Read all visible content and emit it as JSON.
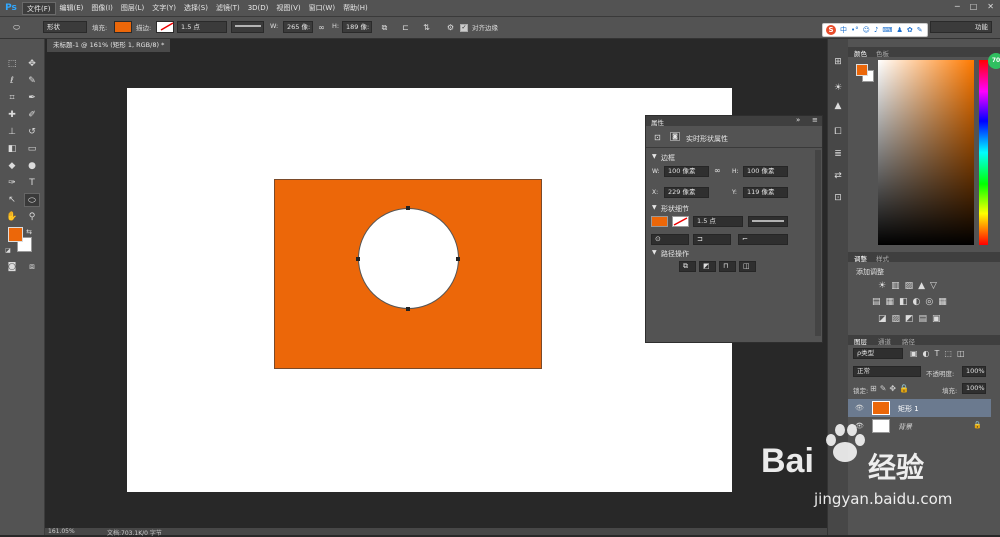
{
  "app": {
    "logo": "Ps"
  },
  "menu": [
    "文件(F)",
    "编辑(E)",
    "图像(I)",
    "图层(L)",
    "文字(Y)",
    "选择(S)",
    "滤镜(T)",
    "3D(D)",
    "视图(V)",
    "窗口(W)",
    "帮助(H)"
  ],
  "options": {
    "shape_mode": "形状",
    "fill_label": "填充:",
    "stroke_label": "描边:",
    "stroke_width": "1.5 点",
    "w_label": "W:",
    "w_value": "265 像:",
    "h_label": "H:",
    "h_value": "189 像:",
    "align_edges": "对齐边缘",
    "workspace": "功能"
  },
  "document": {
    "tab_title": "未标题-1 @ 161% (矩形 1, RGB/8) *",
    "fill_color": "#ec6709"
  },
  "properties": {
    "tab": "属性",
    "title": "实时形状属性",
    "section_bounds": "边框",
    "w_label": "W:",
    "w_value": "100 像素",
    "h_label": "H:",
    "h_value": "100 像素",
    "x_label": "X:",
    "x_value": "229 像素",
    "y_label": "Y:",
    "y_value": "119 像素",
    "section_shape": "形状细节",
    "stroke_width": "1.5 点",
    "section_path": "路径操作"
  },
  "color_panel": {
    "tabs": [
      "颜色",
      "色板"
    ],
    "progress_badge": "70"
  },
  "adjust_panel": {
    "tabs": [
      "调整",
      "样式"
    ],
    "title": "添加调整"
  },
  "layers_panel": {
    "tabs": [
      "图层",
      "通道",
      "路径"
    ],
    "filter": "ρ类型",
    "blend": "正常",
    "opacity_label": "不透明度:",
    "opacity": "100%",
    "lock_label": "锁定:",
    "fill_label": "填充:",
    "fill": "100%",
    "layers": [
      {
        "name": "矩形 1"
      },
      {
        "name": "背景"
      }
    ]
  },
  "status": {
    "zoom": "161.05%",
    "doc_info": "文档:703.1K/0 字节"
  },
  "watermark": {
    "brand": "Bai",
    "brand2": "经验",
    "url": "jingyan.baidu.com"
  }
}
